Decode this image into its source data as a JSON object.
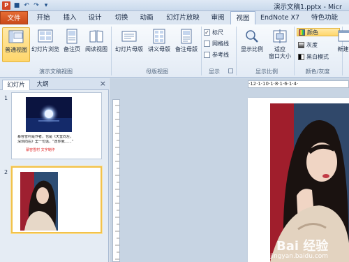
{
  "window": {
    "title": "演示文稿1.pptx - Micr"
  },
  "qat": {
    "save_icon": "save-icon",
    "undo_icon": "undo-icon",
    "redo_icon": "redo-icon",
    "more_icon": "customize-icon"
  },
  "tabs": [
    {
      "label": "文件"
    },
    {
      "label": "开始"
    },
    {
      "label": "插入"
    },
    {
      "label": "设计"
    },
    {
      "label": "切换"
    },
    {
      "label": "动画"
    },
    {
      "label": "幻灯片放映"
    },
    {
      "label": "审阅"
    },
    {
      "label": "视图"
    },
    {
      "label": "EndNote X7"
    },
    {
      "label": "特色功能"
    }
  ],
  "ribbon": {
    "presentation_views": {
      "normal": "普通视图",
      "sorter": "幻灯片浏览",
      "notes": "备注页",
      "reading": "阅读视图",
      "group": "演示文稿视图"
    },
    "master_views": {
      "slide_master": "幻灯片母版",
      "handout_master": "讲义母版",
      "notes_master": "备注母版",
      "group": "母版视图"
    },
    "show": {
      "ruler": "标尺",
      "gridlines": "网格线",
      "guides": "参考线",
      "ruler_checked": true,
      "group": "显示"
    },
    "zoom": {
      "zoom": "显示比例",
      "fit": "适应",
      "fit2": "窗口大小",
      "group": "显示比例"
    },
    "color": {
      "color": "颜色",
      "grayscale": "灰度",
      "bw": "黑白模式",
      "group": "颜色/灰度"
    },
    "new_window": "新建"
  },
  "panel": {
    "tab_slides": "幻灯片",
    "tab_outline": "大纲",
    "close": "×",
    "slides": [
      {
        "number": "1",
        "line1": "慕容雪村是作者，也是《天堂向左，",
        "line2": "深圳向右》里一句话，“愿你我……”",
        "signature": "慕容雪村  文字制作"
      },
      {
        "number": "2"
      }
    ]
  },
  "ruler": {
    "marks": "·12·1·10·1·8·1·6·1·4·"
  },
  "watermark": {
    "logo": "Bai 经验",
    "url": "jingyan.baidu.com"
  },
  "colors": {
    "file_tab": "#d9581f",
    "selected": "#ffd66b",
    "ribbon_bg": "#eef3f9"
  }
}
